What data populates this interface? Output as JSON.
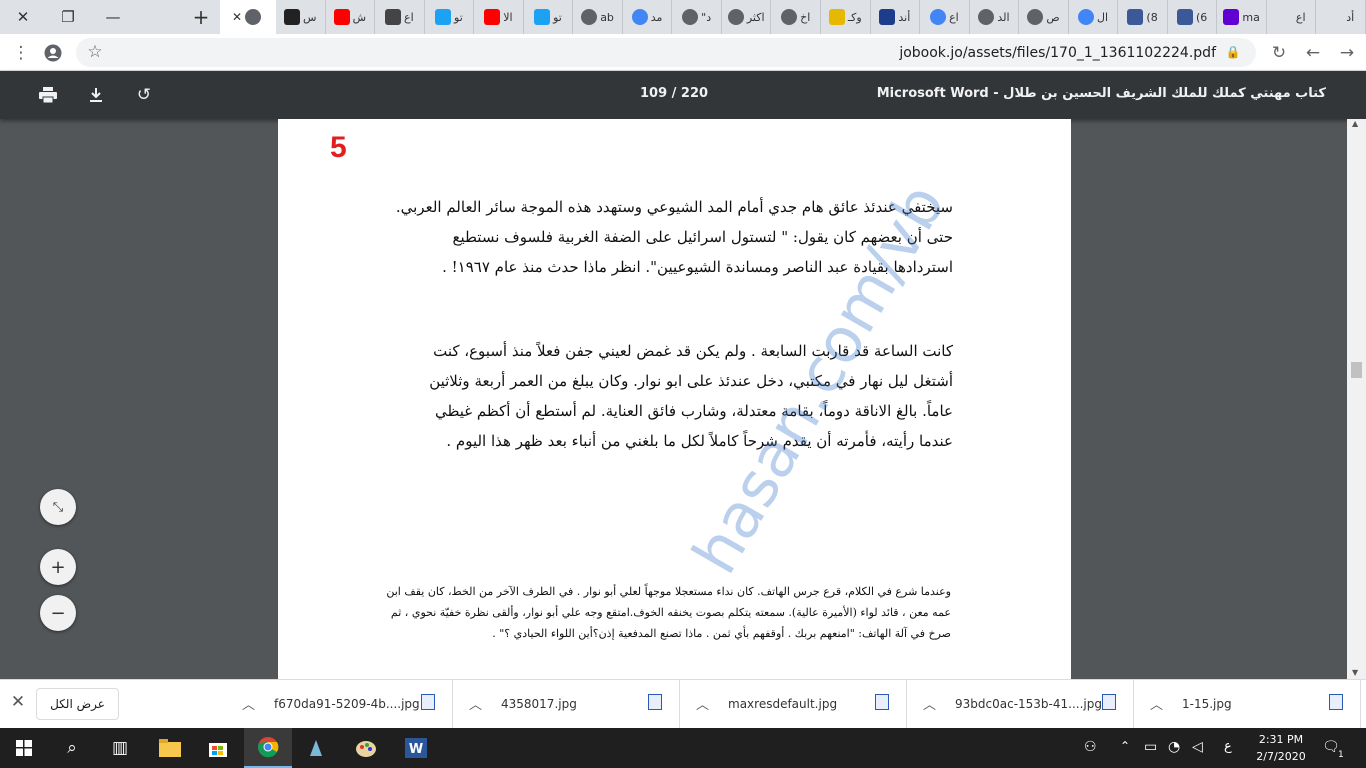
{
  "browser": {
    "tabs": [
      {
        "label": "",
        "favicon": "globe",
        "color": "#5f6368",
        "active": true
      },
      {
        "label": "س",
        "favicon": "d-logo",
        "color": "#222222"
      },
      {
        "label": "ش",
        "favicon": "youtube",
        "color": "#ff0000"
      },
      {
        "label": "اع",
        "favicon": "news",
        "color": "#444444"
      },
      {
        "label": "تو",
        "favicon": "twitter",
        "color": "#1da1f2"
      },
      {
        "label": "الا",
        "favicon": "youtube",
        "color": "#ff0000"
      },
      {
        "label": "تو",
        "favicon": "twitter",
        "color": "#1da1f2"
      },
      {
        "label": "ab",
        "favicon": "globe",
        "color": "#5f6368"
      },
      {
        "label": "مد",
        "favicon": "google",
        "color": "#4285f4"
      },
      {
        "label": "\"د",
        "favicon": "globe",
        "color": "#5f6368"
      },
      {
        "label": "اكثر",
        "favicon": "globe",
        "color": "#5f6368"
      },
      {
        "label": "اخ",
        "favicon": "globe",
        "color": "#5f6368"
      },
      {
        "label": "وكـ",
        "favicon": "star",
        "color": "#e6b800"
      },
      {
        "label": "أند",
        "favicon": "sky-news",
        "color": "#1e3c8c"
      },
      {
        "label": "اع",
        "favicon": "google",
        "color": "#4285f4"
      },
      {
        "label": "الد",
        "favicon": "globe",
        "color": "#5f6368"
      },
      {
        "label": "ص",
        "favicon": "globe",
        "color": "#5f6368"
      },
      {
        "label": "ال",
        "favicon": "google",
        "color": "#4285f4"
      },
      {
        "label": "(8",
        "favicon": "facebook",
        "color": "#3b5998"
      },
      {
        "label": "(6",
        "favicon": "facebook",
        "color": "#3b5998"
      },
      {
        "label": "ma",
        "favicon": "mail",
        "color": "#6001d2"
      },
      {
        "label": "اع",
        "favicon": "blank",
        "color": "#dee1e6"
      },
      {
        "label": "أد",
        "favicon": "blank",
        "color": "#dee1e6"
      }
    ],
    "new_tab_icon": "plus-icon",
    "url": "jobook.jo/assets/files/170_1_1361102224.pdf"
  },
  "pdf": {
    "title": "Microsoft Word - كتاب مهنتي كملك للملك الشريف الحسين بن طلال",
    "page_counter": "109 / 220",
    "page_number_label": "5",
    "paragraph1": [
      "سيختفي عندئذ عائق هام جدي أمام المد الشيوعي وستهدد هذه الموجة سائر العالم العربي.",
      "حتى أن بعضهم كان يقول: \" لتستول اسرائيل على الضفة الغربية فلسوف نستطيع",
      "استردادها بقيادة عبد الناصر ومساندة الشيوعيين\". انظر ماذا حدث منذ عام ١٩٦٧! ."
    ],
    "paragraph2": [
      "كانت الساعة قد قاربت السابعة . ولم يكن قد غمض لعيني جفن فعلاً منذ أسبوع، كنت",
      "أشتغل ليل نهار في مكتبي، دخل عندئذ على ابو نوار. وكان يبلغ من العمر أربعة وثلاثين",
      "عاماً. بالغ الاناقة دوماً، بقامة معتدلة، وشارب فائق العناية. لم أستطع أن أكظم غيظي",
      "عندما رأيته، فأمرته أن يقدم شرحاً كاملاً لكل ما بلغني من أنباء بعد ظهر هذا اليوم ."
    ],
    "footnote": [
      "وعندما شرع في الكلام، قرع جرس الهاتف. كان نداء مستعجلا موجهاً لعلي أبو نوار . في الطرف الآخر من الخط، كان يقف ابن",
      "عمه معن ، قائد لواء (الأميرة عالية). سمعته يتكلم بصوت يخنقه الخوف.امتقع وجه علي أبو نوار، وألقى نظرة خفيّة نحوي ، ثم",
      "صرخ في آلة الهاتف: \"امنعهم بربك . أوقفهم بأي ثمن . ماذا تصنع المدفعية إذن؟أين اللواء الحيادي ؟\" ."
    ],
    "watermark": "hasan.com/vb"
  },
  "downloads": {
    "show_all_label": "عرض الكل",
    "items": [
      {
        "name": "1-15.jpg"
      },
      {
        "name": "93bdc0ac-153b-41....jpg"
      },
      {
        "name": "maxresdefault.jpg"
      },
      {
        "name": "4358017.jpg"
      },
      {
        "name": "f670da91-5209-4b....jpg"
      }
    ]
  },
  "taskbar": {
    "time": "2:31 PM",
    "date": "2/7/2020",
    "lang": "ع",
    "notifications": "1"
  }
}
